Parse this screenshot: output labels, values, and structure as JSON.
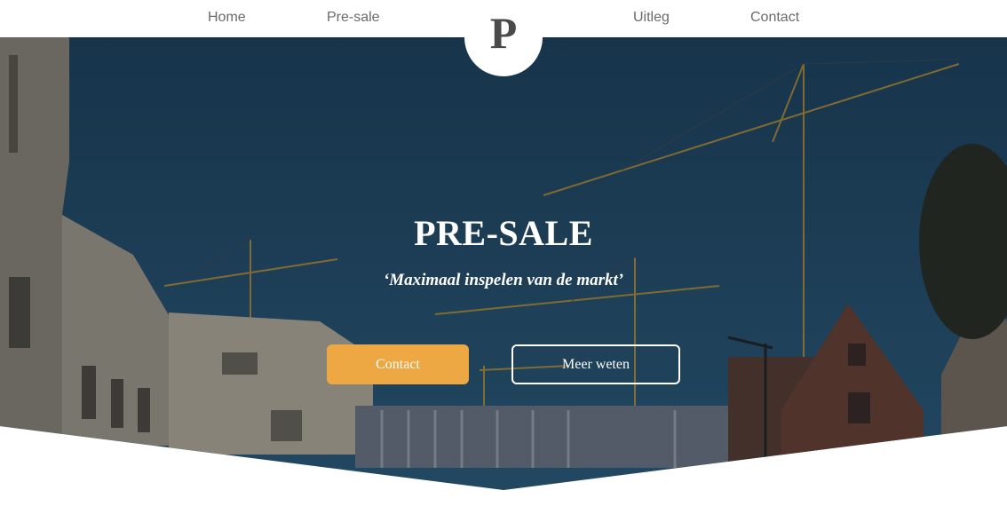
{
  "nav": {
    "items": [
      {
        "label": "Home"
      },
      {
        "label": "Pre-sale"
      },
      {
        "label": "Uitleg"
      },
      {
        "label": "Contact"
      }
    ],
    "logo_letter": "P"
  },
  "hero": {
    "title": "PRE-SALE",
    "subtitle": "‘Maximaal inspelen van de markt’",
    "buttons": {
      "contact": "Contact",
      "more": "Meer weten"
    }
  },
  "colors": {
    "accent": "#eda843",
    "sky_overlay": "#1f4560",
    "nav_text": "#6a6a6a"
  }
}
